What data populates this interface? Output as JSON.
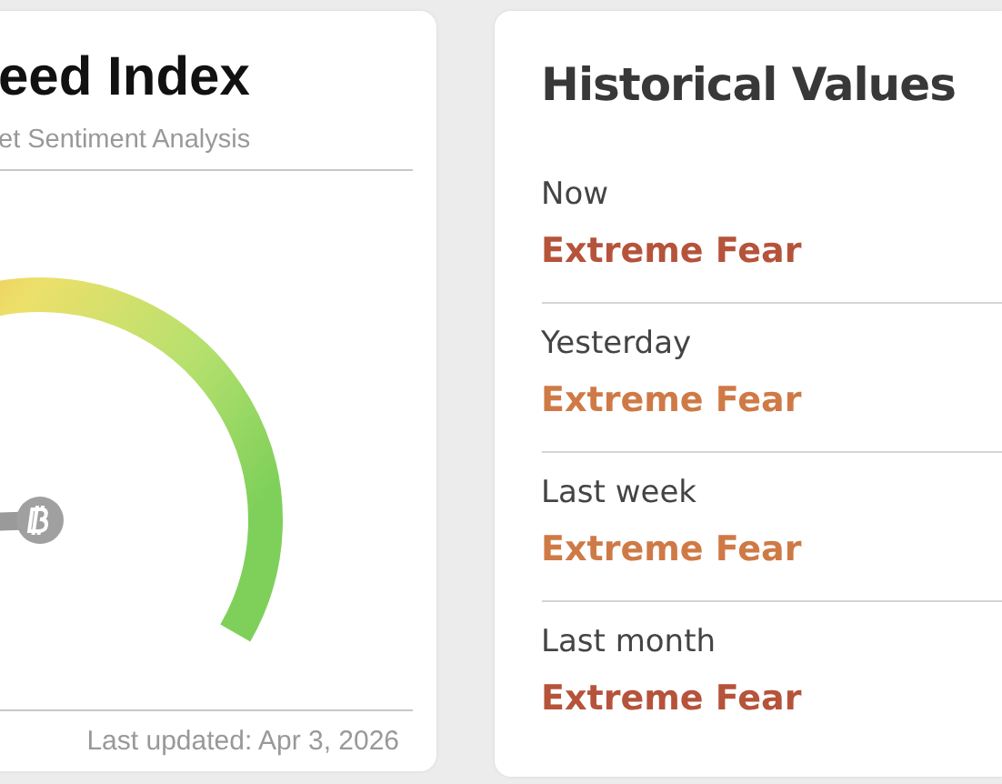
{
  "index_card": {
    "title": "eed Index",
    "subtitle": "et Sentiment Analysis",
    "last_updated": "Last updated: Apr 3, 2026"
  },
  "historical_values": {
    "title": "Historical Values",
    "rows": [
      {
        "label": "Now",
        "value": "Extreme Fear",
        "color": "#b5533b"
      },
      {
        "label": "Yesterday",
        "value": "Extreme Fear",
        "color": "#cf7a46"
      },
      {
        "label": "Last week",
        "value": "Extreme Fear",
        "color": "#cf7a46"
      },
      {
        "label": "Last month",
        "value": "Extreme Fear",
        "color": "#b5533b"
      }
    ]
  }
}
